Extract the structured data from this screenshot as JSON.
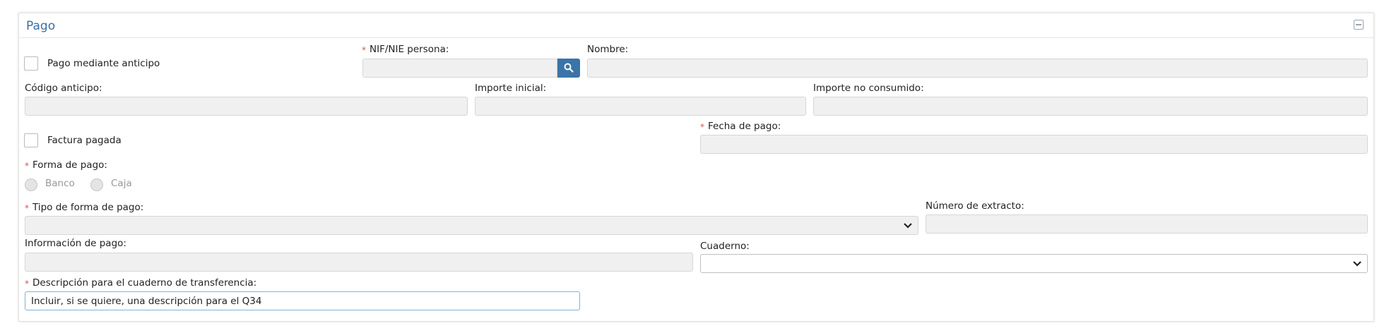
{
  "panel": {
    "title": "Pago"
  },
  "fields": {
    "pago_anticipo_label": "Pago mediante anticipo",
    "nif_label": "NIF/NIE persona:",
    "nombre_label": "Nombre:",
    "codigo_anticipo_label": "Código anticipo:",
    "importe_inicial_label": "Importe inicial:",
    "importe_no_consumido_label": "Importe no consumido:",
    "factura_pagada_label": "Factura pagada",
    "fecha_pago_label": "Fecha de pago:",
    "forma_pago_label": "Forma de pago:",
    "banco_label": "Banco",
    "caja_label": "Caja",
    "tipo_forma_pago_label": "Tipo de forma de pago:",
    "numero_extracto_label": "Número de extracto:",
    "informacion_pago_label": "Información de pago:",
    "cuaderno_label": "Cuaderno:",
    "descripcion_label": "Descripción para el cuaderno de transferencia:",
    "descripcion_value": "Incluir, si se quiere, una descripción para el Q34"
  },
  "required_marker": "*",
  "colors": {
    "accent": "#3a74a8",
    "title": "#3a6ea5",
    "required": "#d9534f"
  }
}
